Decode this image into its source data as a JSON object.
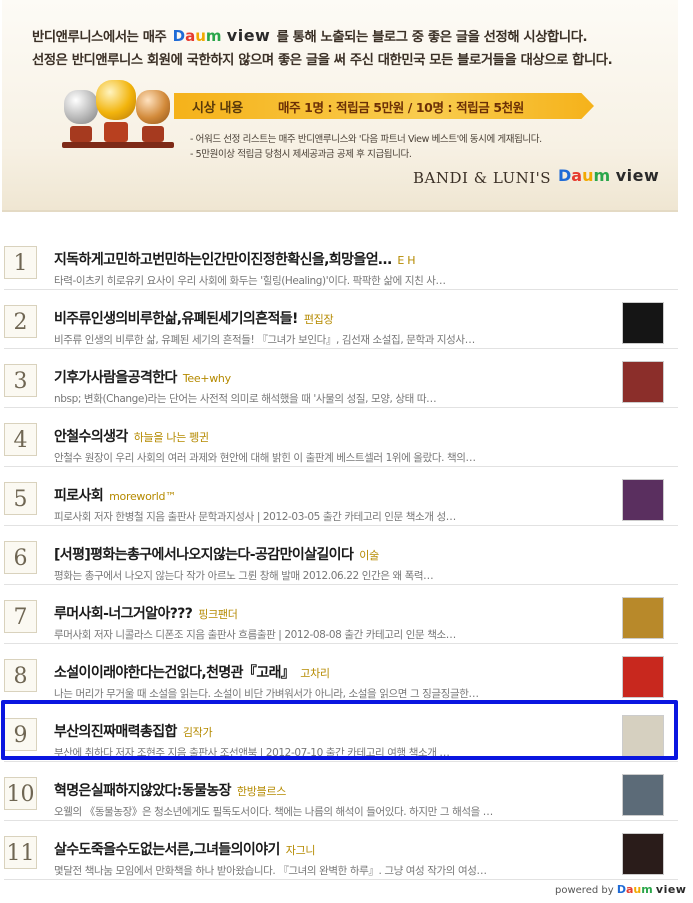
{
  "banner": {
    "line1_before": "반디앤루니스에서는 매주",
    "line1_after": "를 통해 노출되는 블로그 중 좋은 글을 선정해 시상합니다.",
    "line2": "선정은 반디앤루니스 회원에 국한하지 않으며 좋은 글을 써 주신 대한민국 모든 블로거들을 대상으로 합니다.",
    "daum_logo": {
      "d": "D",
      "a": "a",
      "u": "u",
      "m": "m"
    },
    "view_logo": "view",
    "award_title": "시상 내용",
    "award_detail": "매주 1명 : 적립금 5만원 / 10명 : 적립금 5천원",
    "note1": "- 어워드 선정 리스트는 매주 반디앤루니스와 '다음 파트너 View 베스트'에 동시에 게재됩니다.",
    "note2": "- 5만원이상 적립금 당첨시 제세공과금 공제 후 지급됩니다.",
    "bandi_brand": "BANDI & LUNI'S",
    "icon": "trophies-icon"
  },
  "items": [
    {
      "rank": "1",
      "title": "지독하게고민하고번민하는인간만이진정한확신을,희망을얻…",
      "author": "E H",
      "summary": "타력-이츠키 히로유키 요사이 우리 사회에 화두는 '힐링(Healing)'이다. 팍팍한 삶에 지친 사…",
      "thumb_color": ""
    },
    {
      "rank": "2",
      "title": "비주류인생의비루한삶,유폐된세기의흔적들!",
      "author": "편집장",
      "summary": "비주류 인생의 비루한 삶, 유폐된 세기의 흔적들! 『그녀가 보인다』, 김선재 소설집, 문학과 지성사…",
      "thumb_color": "#151515"
    },
    {
      "rank": "3",
      "title": "기후가사람을공격한다",
      "author": "Tee+why",
      "summary": "nbsp; 변화(Change)라는 단어는 사전적 의미로 해석했을 때 '사물의 성질, 모양, 상태 따…",
      "thumb_color": "#8b2e2a"
    },
    {
      "rank": "4",
      "title": "안철수의생각",
      "author": "하늘을 나는 펭귄",
      "summary": "안철수 원장이 우리 사회의 여러 과제와 현안에 대해 밝힌 이 출판계 베스트셀러 1위에 올랐다. 책의…",
      "thumb_color": ""
    },
    {
      "rank": "5",
      "title": "피로사회",
      "author": "moreworld™",
      "summary": "피로사회 저자 한병철 지음 출판사 문학과지성사 | 2012-03-05 출간 카테고리 인문 책소개 성…",
      "thumb_color": "#5a2f5f"
    },
    {
      "rank": "6",
      "title": "[서평]평화는총구에서나오지않는다-공감만이살길이다",
      "author": "이술",
      "summary": "평화는 총구에서 나오지 않는다 작가 아르노 그륀 창해 발매 2012.06.22 인간은 왜 폭력…",
      "thumb_color": ""
    },
    {
      "rank": "7",
      "title": "루머사회-너그거알아???",
      "author": "핑크팬더",
      "summary": "루머사회 저자 니콜라스 디폰조 지음 출판사 흐름출판 | 2012-08-08 출간 카테고리 인문 책소…",
      "thumb_color": "#b8892a"
    },
    {
      "rank": "8",
      "title": "소설이이래야한다는건없다,천명관『고래』",
      "author": "고차리",
      "summary": "나는 머리가 무거울 때 소설을 읽는다. 소설이 비단 가벼워서가 아니라, 소설을 읽으면 그 징글징글한…",
      "thumb_color": "#c8281e"
    },
    {
      "rank": "9",
      "title": "부산의진짜매력총집합",
      "author": "김작가",
      "summary": "부산에 취하다 저자 조현주 지음 출판사 조선앤북 | 2012-07-10 출간 카테고리 여행 책소개 …",
      "thumb_color": "#d6d0c0"
    },
    {
      "rank": "10",
      "title": "혁명은실패하지않았다:동물농장",
      "author": "한방블르스",
      "summary": "오웰의 《동물농장》은 청소년에게도 필독도서이다. 책에는 나름의 해석이 들어있다. 하지만 그 해석을 …",
      "thumb_color": "#5c6b78"
    },
    {
      "rank": "11",
      "title": "살수도죽을수도없는서른,그녀들의이야기",
      "author": "자그니",
      "summary": "몇달전 책나눔 모임에서 만화책을 하나 받아왔습니다. 『그녀의 완벽한 하루』. 그냥 여성 작가의 여성…",
      "thumb_color": "#2a1c1a"
    }
  ],
  "footer": {
    "powered_by": "powered by"
  }
}
